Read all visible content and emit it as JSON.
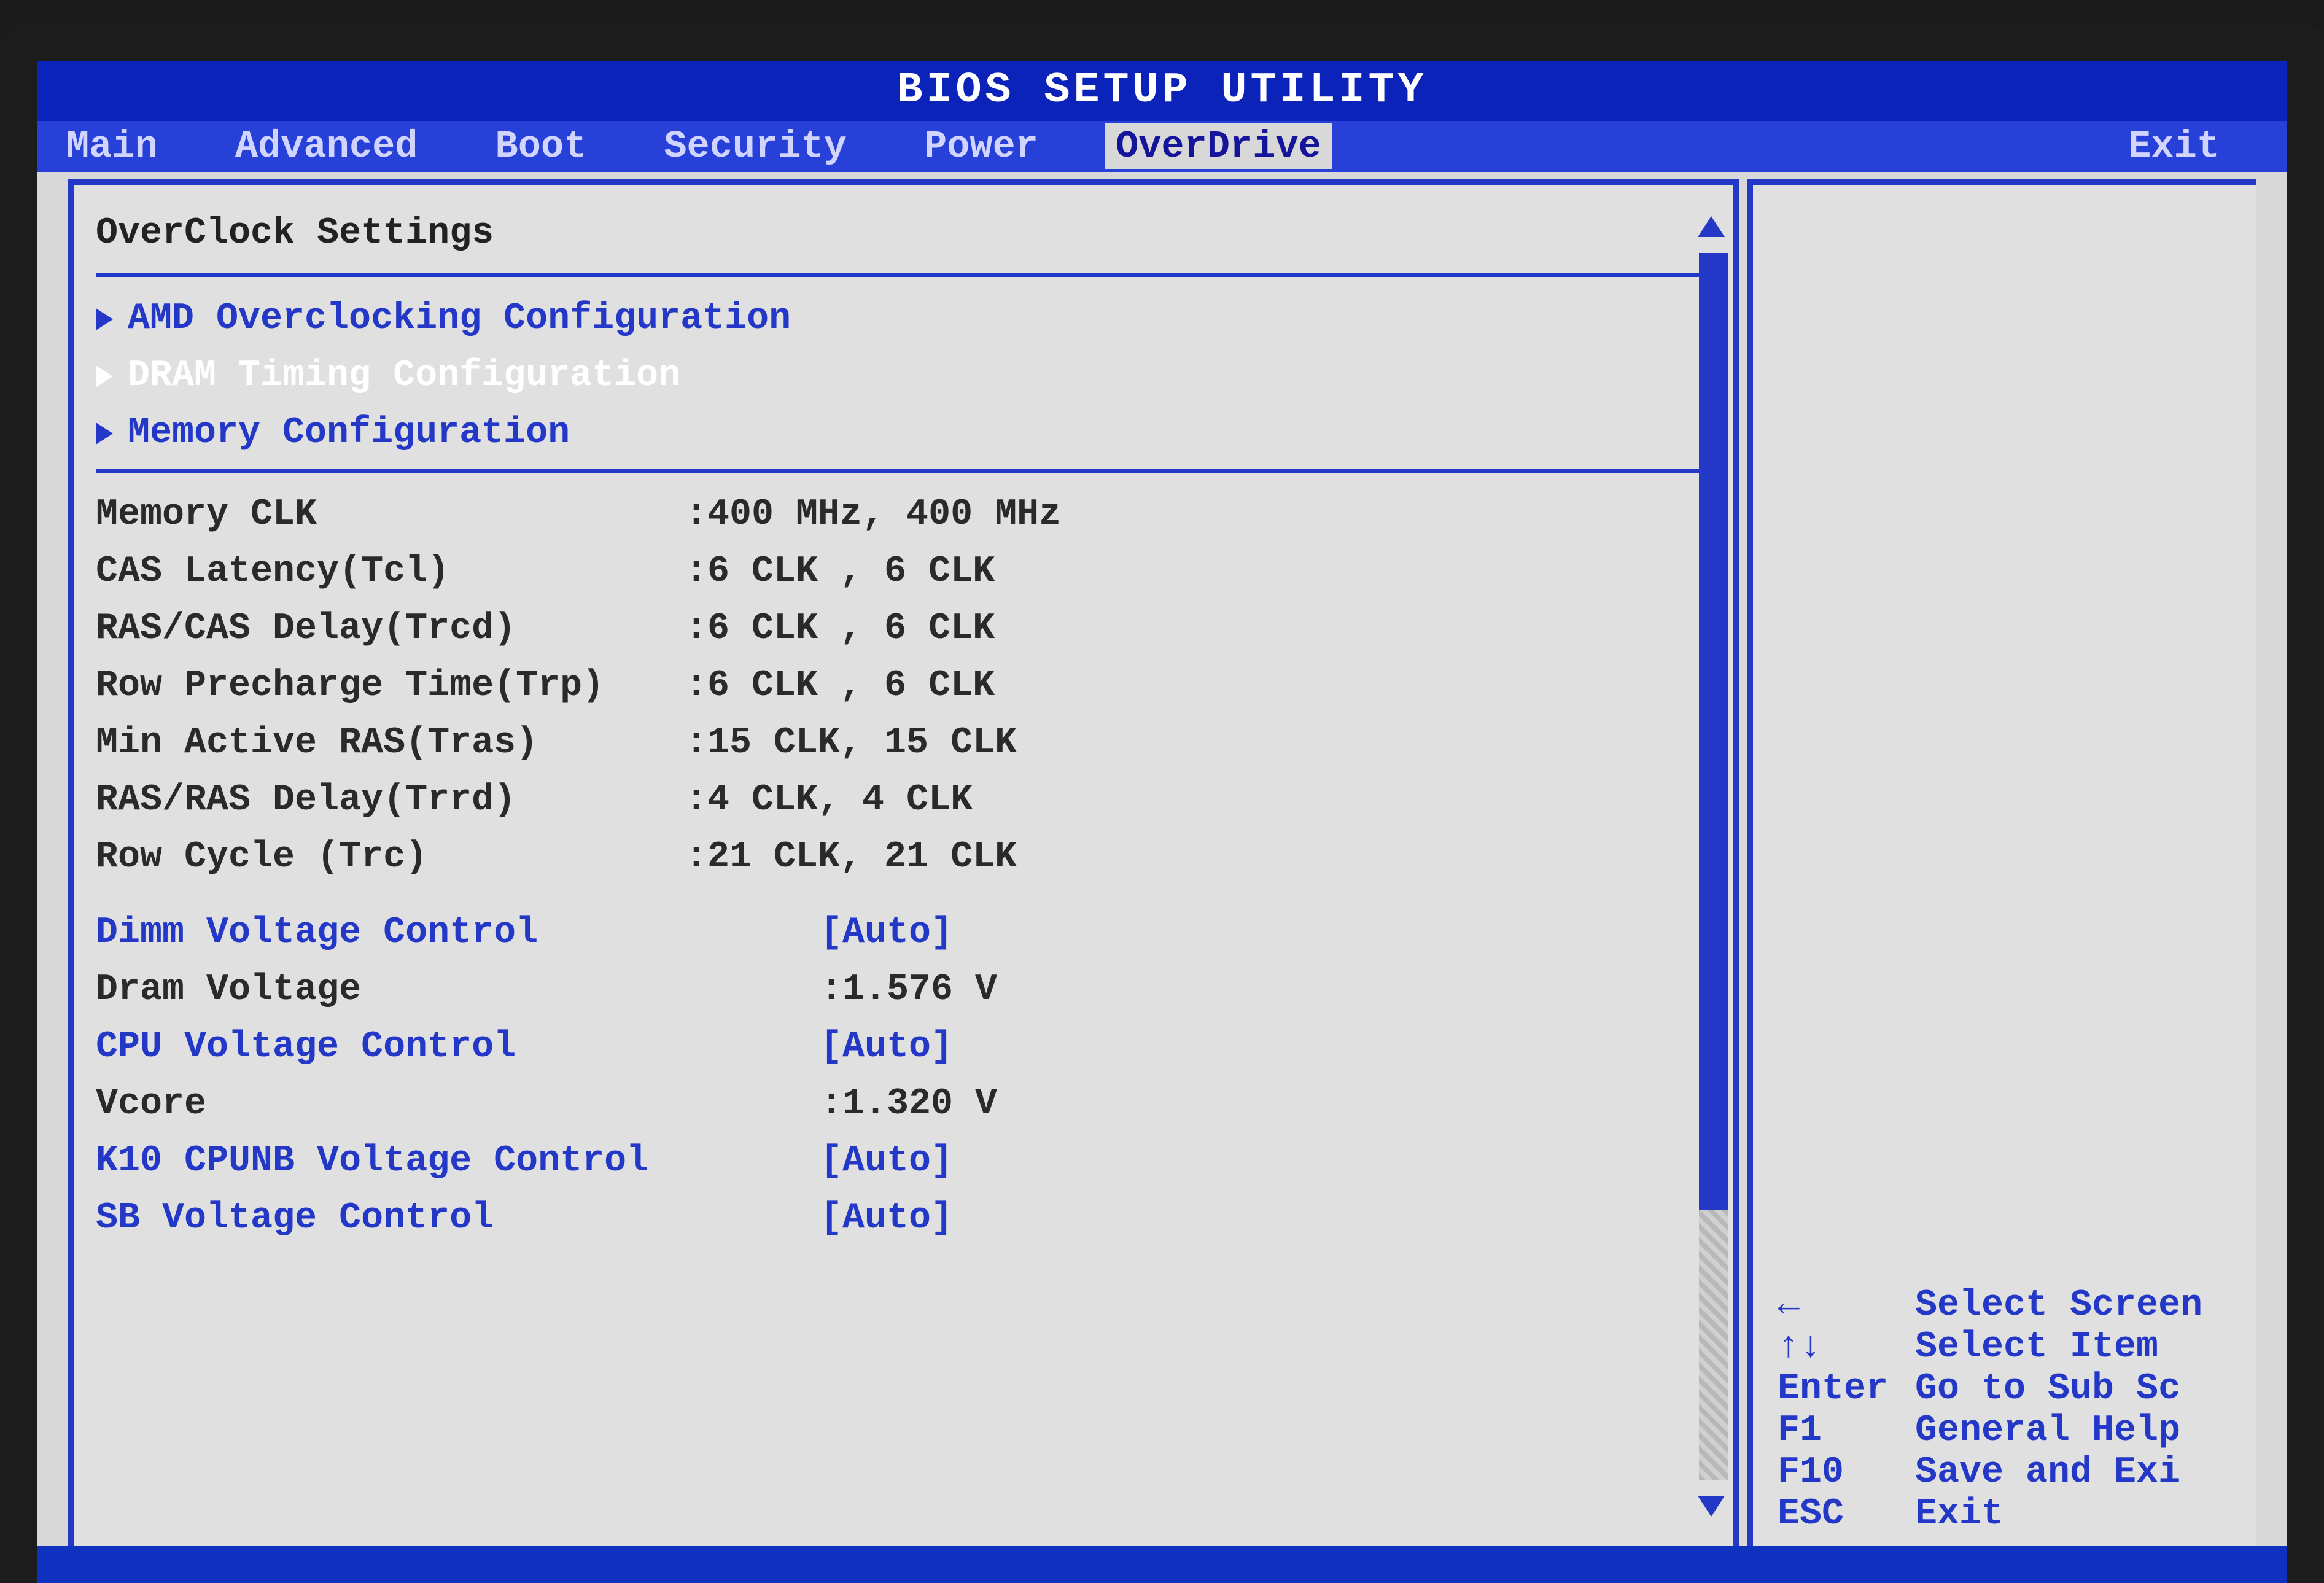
{
  "header": {
    "title": "BIOS SETUP UTILITY"
  },
  "menu": {
    "items": [
      {
        "label": "Main",
        "active": false
      },
      {
        "label": "Advanced",
        "active": false
      },
      {
        "label": "Boot",
        "active": false
      },
      {
        "label": "Security",
        "active": false
      },
      {
        "label": "Power",
        "active": false
      },
      {
        "label": "OverDrive",
        "active": true
      },
      {
        "label": "Exit",
        "active": false
      }
    ]
  },
  "left": {
    "section_title": "OverClock Settings",
    "submenus": [
      {
        "label": "AMD Overclocking Configuration",
        "selected": false
      },
      {
        "label": "DRAM Timing Configuration",
        "selected": true
      },
      {
        "label": "Memory Configuration",
        "selected": false
      }
    ],
    "info": [
      {
        "label": "Memory CLK",
        "value": ":400 MHz, 400 MHz"
      },
      {
        "label": "CAS Latency(Tcl)",
        "value": ":6 CLK , 6 CLK"
      },
      {
        "label": "RAS/CAS Delay(Trcd)",
        "value": ":6 CLK , 6 CLK"
      },
      {
        "label": "Row Precharge Time(Trp)",
        "value": ":6 CLK , 6 CLK"
      },
      {
        "label": "Min Active RAS(Tras)",
        "value": ":15 CLK, 15 CLK"
      },
      {
        "label": "RAS/RAS Delay(Trrd)",
        "value": ":4 CLK, 4 CLK"
      },
      {
        "label": "Row Cycle (Trc)",
        "value": ":21 CLK, 21 CLK"
      }
    ],
    "controls": [
      {
        "label": "Dimm Voltage Control",
        "value": "[Auto]",
        "editable": true
      },
      {
        "label": "Dram Voltage",
        "value": ":1.576 V",
        "editable": false
      },
      {
        "label": "CPU Voltage Control",
        "value": "[Auto]",
        "editable": true
      },
      {
        "label": "Vcore",
        "value": ":1.320 V",
        "editable": false
      },
      {
        "label": "K10 CPUNB Voltage Control",
        "value": "[Auto]",
        "editable": true
      },
      {
        "label": "SB Voltage Control",
        "value": "[Auto]",
        "editable": true
      }
    ]
  },
  "help": [
    {
      "key": "←",
      "text": "Select Screen"
    },
    {
      "key": "↑↓",
      "text": "Select Item"
    },
    {
      "key": "Enter",
      "text": "Go to Sub Sc"
    },
    {
      "key": "F1",
      "text": "General Help"
    },
    {
      "key": "F10",
      "text": "Save and Exi"
    },
    {
      "key": "ESC",
      "text": "Exit"
    }
  ]
}
